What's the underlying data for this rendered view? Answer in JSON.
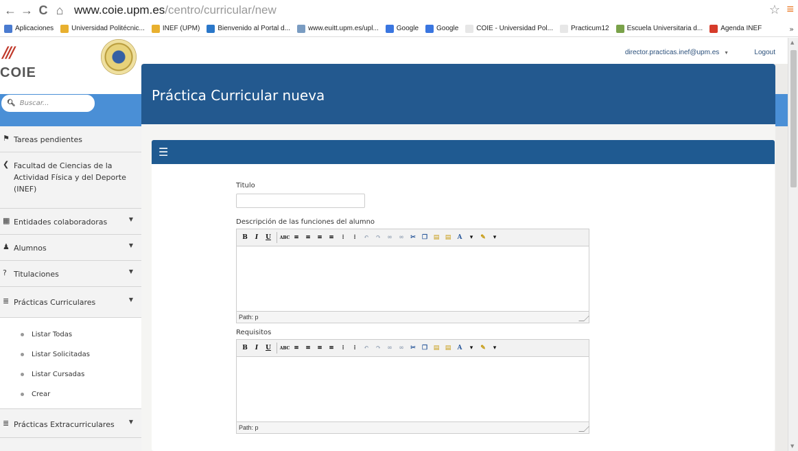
{
  "browser": {
    "back": "←",
    "forward": "→",
    "reload": "C",
    "home": "⌂",
    "url_domain": "www.coie.upm.es",
    "url_path": "/centro/curricular/new",
    "bookmarks": [
      {
        "label": "Aplicaciones",
        "color": "#4a7bd0"
      },
      {
        "label": "Universidad Politécnic...",
        "color": "#e8b02f"
      },
      {
        "label": "INEF (UPM)",
        "color": "#e8b02f"
      },
      {
        "label": "Bienvenido al Portal d...",
        "color": "#2a77c9"
      },
      {
        "label": "www.euitt.upm.es/upl...",
        "color": "#7a9cc2"
      },
      {
        "label": "Google",
        "color": "#3a76e0"
      },
      {
        "label": "Google",
        "color": "#3a76e0"
      },
      {
        "label": "COIE - Universidad Pol...",
        "color": "#e7e7e7"
      },
      {
        "label": "Practicum12",
        "color": "#e7e7e7"
      },
      {
        "label": "Escuela Universitaria d...",
        "color": "#7aa24a"
      },
      {
        "label": "Agenda INEF",
        "color": "#d63b2a"
      }
    ],
    "more": "»"
  },
  "header": {
    "user": "director.practicas.inef@upm.es",
    "user_caret": "▼",
    "logout": "Logout",
    "title": "Práctica Curricular nueva",
    "logo_text": "COIE"
  },
  "search": {
    "placeholder": "Buscar..."
  },
  "sidebar": {
    "items": [
      {
        "icon": "⚑",
        "label": "Tareas pendientes",
        "caret": ""
      },
      {
        "icon": "❮",
        "label": "Facultad de Ciencias de la Actividad Física y del Deporte (INEF)",
        "caret": ""
      },
      {
        "icon": "▦",
        "label": "Entidades colaboradoras",
        "caret": "▼"
      },
      {
        "icon": "♟",
        "label": "Alumnos",
        "caret": "▼"
      },
      {
        "icon": "?",
        "label": "Titulaciones",
        "caret": "▼"
      },
      {
        "icon": "≣",
        "label": "Prácticas Curriculares",
        "caret": "▼"
      }
    ],
    "sub_items": [
      "Listar Todas",
      "Listar Solicitadas",
      "Listar Cursadas",
      "Crear"
    ],
    "last_item": {
      "icon": "≣",
      "label": "Prácticas Extracurriculares",
      "caret": "▼"
    }
  },
  "form": {
    "titulo_label": "Titulo",
    "descripcion_label": "Descripción de las funciones del alumno",
    "requisitos_label": "Requisitos",
    "path_text": "Path: p"
  }
}
